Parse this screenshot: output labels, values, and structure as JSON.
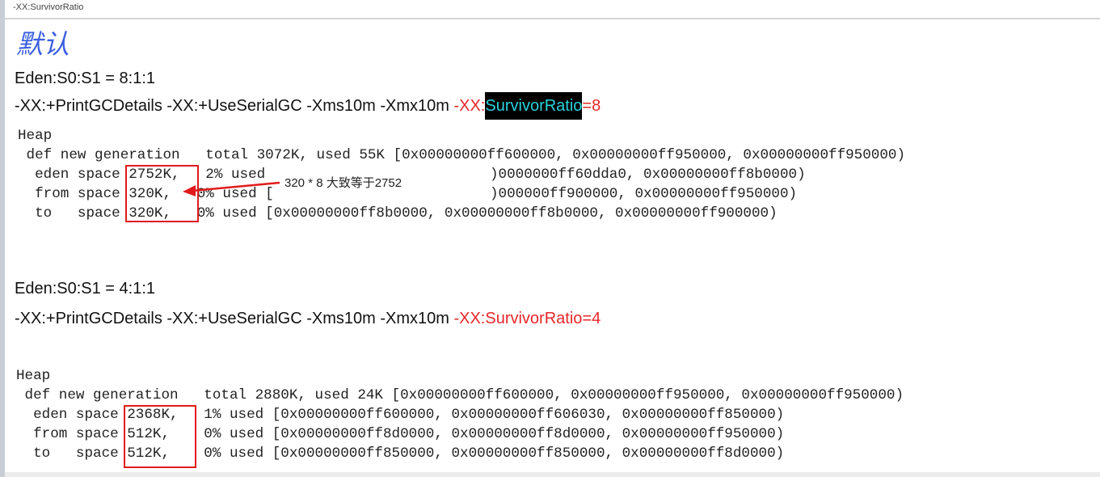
{
  "window": {
    "title": "-XX:SurvivorRatio"
  },
  "heading": "默认",
  "section1": {
    "ratio": "Eden:S0:S1 = 8:1:1",
    "cmd_prefix": "-XX:+PrintGCDetails -XX:+UseSerialGC -Xms10m -Xmx10m ",
    "cmd_flag": "-XX:",
    "cmd_highlight": "SurvivorRatio",
    "cmd_value": "=8",
    "heap": "Heap",
    "def_line": " def new generation   total 3072K, used 55K [0x00000000ff600000, 0x00000000ff950000, 0x00000000ff950000)",
    "eden_prefix": "  eden space 2752K,   2% used",
    "eden_suffix": ")0000000ff60dda0, 0x00000000ff8b0000)",
    "from_prefix": "  from space 320K,   0% used [",
    "from_suffix": ")000000ff900000, 0x00000000ff950000)",
    "to_line": "  to   space 320K,   0% used [0x00000000ff8b0000, 0x00000000ff8b0000, 0x00000000ff900000)",
    "annotation": "320 * 8 大致等于2752",
    "annotation_color": "#e01b1b"
  },
  "section2": {
    "ratio": "Eden:S0:S1 = 4:1:1",
    "cmd_prefix": "-XX:+PrintGCDetails -XX:+UseSerialGC -Xms10m -Xmx10m ",
    "cmd_flag": "-XX:SurvivorRatio=4",
    "heap": "Heap",
    "def_line": " def new generation   total 2880K, used 24K [0x00000000ff600000, 0x00000000ff950000, 0x00000000ff950000)",
    "eden_line": "  eden space 2368K,   1% used [0x00000000ff600000, 0x00000000ff606030, 0x00000000ff850000)",
    "from_line": "  from space 512K,    0% used [0x00000000ff8d0000, 0x00000000ff8d0000, 0x00000000ff950000)",
    "to_line": "  to   space 512K,    0% used [0x00000000ff850000, 0x00000000ff850000, 0x00000000ff8d0000)"
  }
}
